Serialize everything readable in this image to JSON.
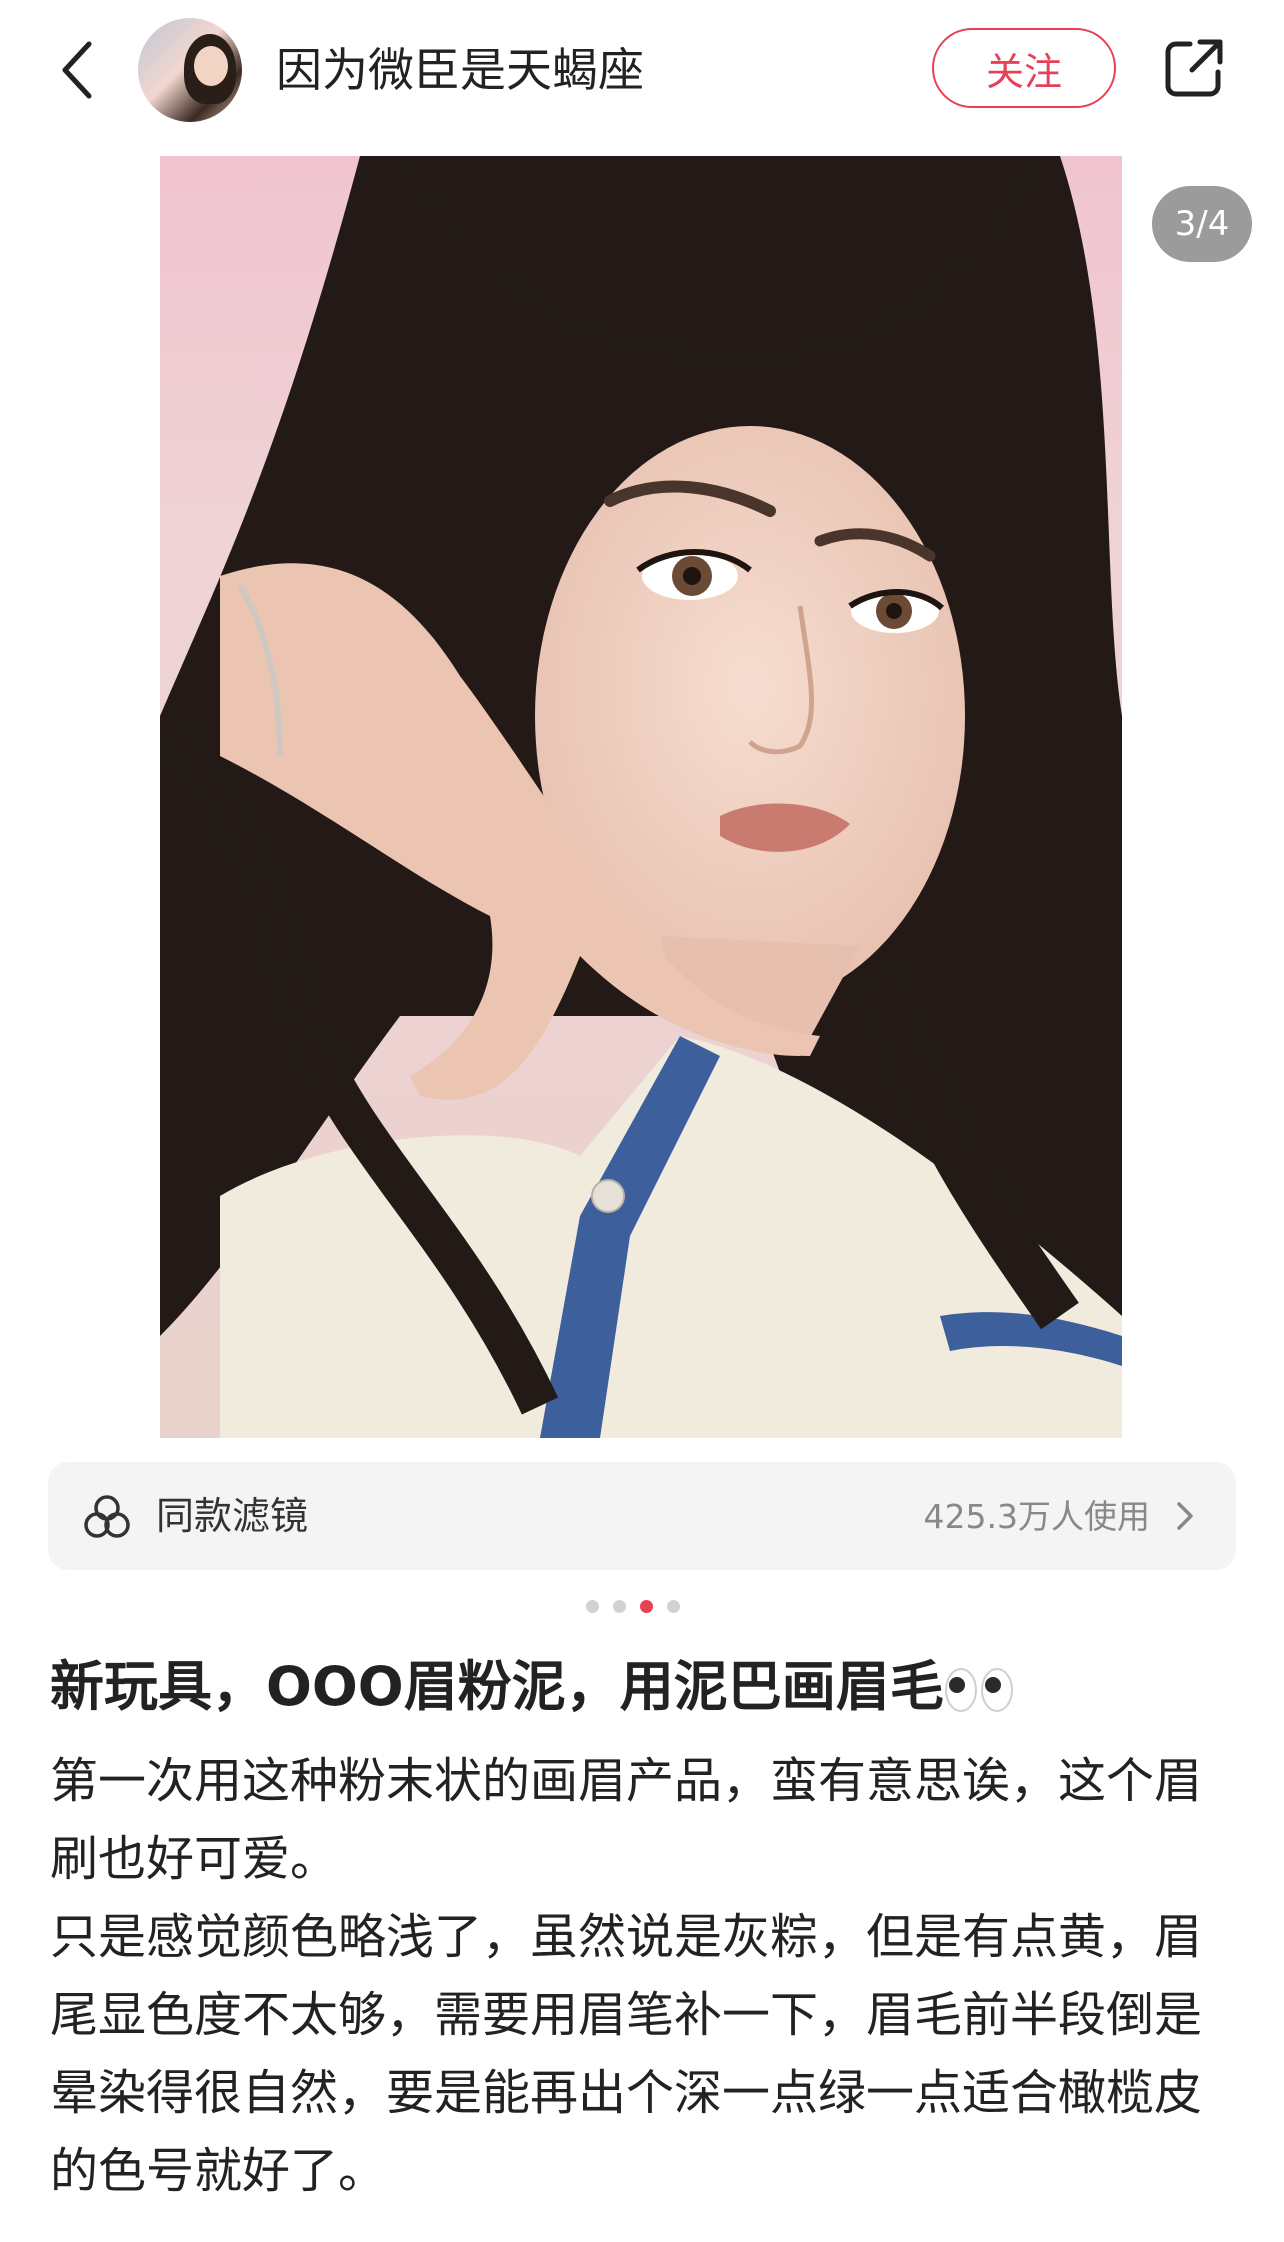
{
  "header": {
    "back_icon": "chevron-left-icon",
    "username": "因为微臣是天蝎座",
    "follow_label": "关注",
    "share_icon": "share-icon",
    "accent_color": "#e84057"
  },
  "photo": {
    "counter": "3/4",
    "current_index": 3,
    "total": 4
  },
  "filter": {
    "icon": "filter-circles-icon",
    "label": "同款滤镜",
    "usage": "425.3万人使用"
  },
  "post": {
    "title": "新玩具，OOO眉粉泥，用泥巴画眉毛",
    "title_emoji": "eyes-emoji",
    "body": [
      "第一次用这种粉末状的画眉产品，蛮有意思诶，这个眉刷也好可爱。",
      "只是感觉颜色略浅了，虽然说是灰粽，但是有点黄，眉尾显色度不太够，需要用眉笔补一下，眉毛前半段倒是晕染得很自然，要是能再出个深一点绿一点适合橄榄皮的色号就好了。"
    ]
  }
}
